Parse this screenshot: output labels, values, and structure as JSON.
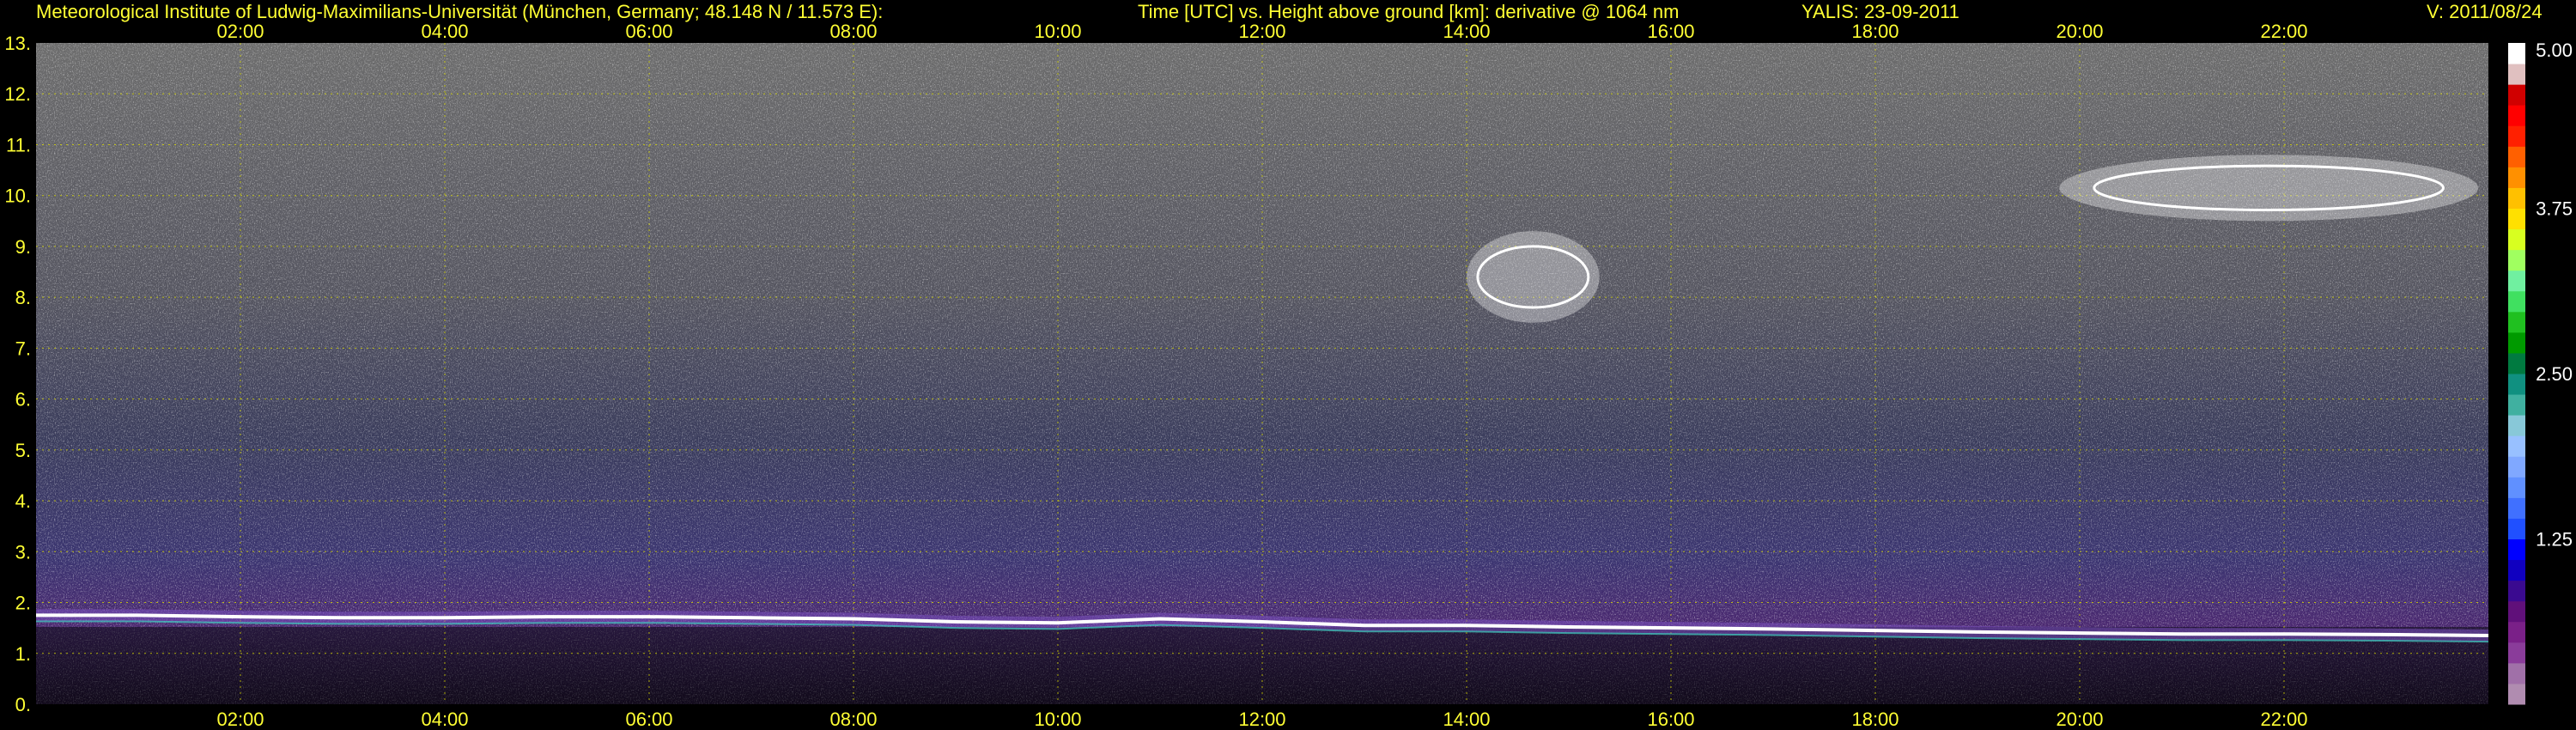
{
  "header": {
    "institute": "Meteorological Institute of Ludwig-Maximilians-Universität (München, Germany; 48.148 N / 11.573 E):",
    "title": "Time [UTC] vs. Height above ground [km]: derivative @ 1064 nm",
    "station": "YALIS: 23-09-2011",
    "version": "V: 2011/08/24"
  },
  "colors": {
    "background": "#000000",
    "axis_text": "#ffff33",
    "grid": "#d8d800",
    "colorbar_text": "#ffffff"
  },
  "chart_data": {
    "type": "heatmap",
    "title": "Time [UTC] vs. Height above ground [km]: derivative @ 1064 nm",
    "x": {
      "unit": "UTC",
      "range": [
        0,
        24
      ],
      "ticks": [
        2,
        4,
        6,
        8,
        10,
        12,
        14,
        16,
        18,
        20,
        22
      ],
      "tick_labels": [
        "02:00",
        "04:00",
        "06:00",
        "08:00",
        "10:00",
        "12:00",
        "14:00",
        "16:00",
        "18:00",
        "20:00",
        "22:00"
      ]
    },
    "y": {
      "unit": "km",
      "range": [
        0,
        13
      ],
      "ticks": [
        0,
        1,
        2,
        3,
        4,
        5,
        6,
        7,
        8,
        9,
        10,
        11,
        12,
        13
      ],
      "tick_labels": [
        "0.",
        "1.",
        "2.",
        "3.",
        "4.",
        "5.",
        "6.",
        "7.",
        "8.",
        "9.",
        "10.",
        "11.",
        "12.",
        "13."
      ]
    },
    "grid": true,
    "colorbar": {
      "range": [
        0,
        5
      ],
      "tick_values": [
        1.25,
        2.5,
        3.75,
        5.0
      ],
      "tick_labels": [
        "1.25",
        "2.50",
        "3.75",
        "5.00"
      ],
      "colors": [
        "#b08cb0",
        "#a070a8",
        "#8a3c9a",
        "#7a2088",
        "#60107a",
        "#3a0a90",
        "#1000c0",
        "#0000ff",
        "#2050ff",
        "#4070ff",
        "#6090ff",
        "#80a8ff",
        "#98c0ff",
        "#88c8d8",
        "#40b0a0",
        "#109080",
        "#007a40",
        "#009a00",
        "#20c020",
        "#40e060",
        "#70f0a0",
        "#a0ff60",
        "#d8ff20",
        "#ffe000",
        "#ffc000",
        "#ff9000",
        "#ff6000",
        "#ff2000",
        "#ff0000",
        "#d00000",
        "#e0c0c0",
        "#ffffff"
      ]
    },
    "features": [
      {
        "name": "boundary-layer top",
        "time_start": 0.0,
        "time_end": 24.0,
        "height_km": [
          1.75,
          1.75,
          1.72,
          1.7,
          1.7,
          1.72,
          1.72,
          1.7,
          1.68,
          1.62,
          1.6,
          1.68,
          1.62,
          1.55,
          1.55,
          1.52,
          1.5,
          1.48,
          1.45,
          1.42,
          1.4,
          1.38,
          1.38,
          1.37,
          1.35
        ]
      },
      {
        "name": "cirrus layer",
        "time_start": 19.8,
        "time_end": 23.9,
        "height_km": [
          9.5,
          10.8
        ]
      },
      {
        "name": "mid-level cloud",
        "time_start": 14.0,
        "time_end": 15.3,
        "height_km": [
          7.5,
          9.3
        ]
      }
    ]
  }
}
